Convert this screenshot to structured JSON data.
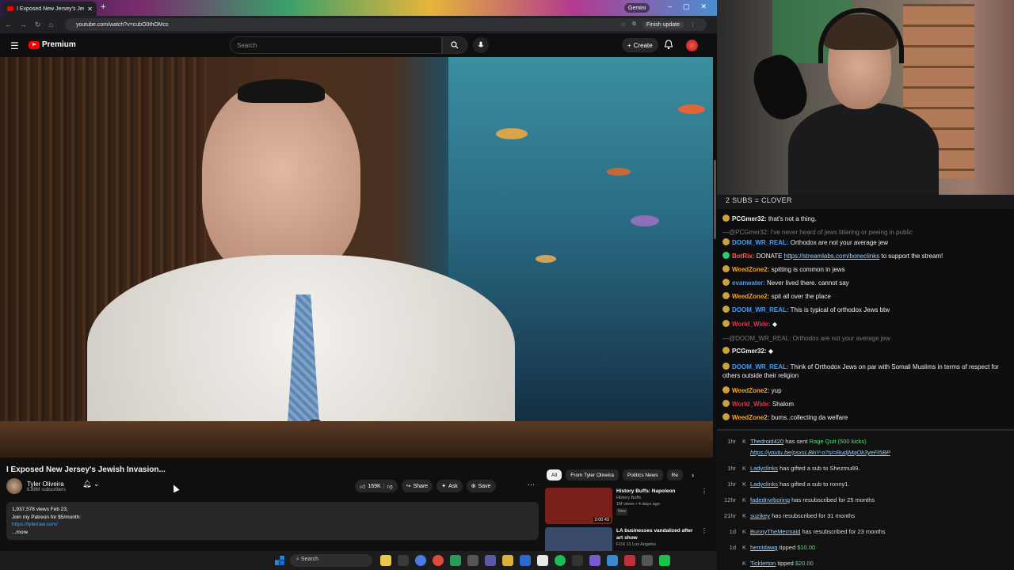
{
  "browser": {
    "tab_title": "I Exposed New Jersey's Jew",
    "badge": "Gemini",
    "url": "youtube.com/watch?v=cubO0thOMcs",
    "finish_update": "Finish update"
  },
  "youtube": {
    "logo_text": "Premium",
    "search_placeholder": "Search",
    "create_label": "Create"
  },
  "video": {
    "title": "I Exposed New Jersey's Jewish Invasion...",
    "channel_name": "Tyler Oliveira",
    "subscribers": "8.88M subscribers",
    "likes": "169K",
    "share_label": "Share",
    "ask_label": "Ask",
    "save_label": "Save",
    "desc_stats": "1,937,578 views  Feb 23,",
    "desc_line2": "Join my Patreon for $5/month:",
    "desc_link": "https://tylerraw.com/",
    "desc_more": "...more"
  },
  "related": {
    "chips": [
      "All",
      "From Tyler Oliveira",
      "Politics News",
      "Re"
    ],
    "items": [
      {
        "title": "History Buffs: Napoleon",
        "channel": "History Buffs",
        "meta": "1M views • 4 days ago",
        "badge": "New",
        "duration": "2:00:43",
        "thumb_color": "#7a1f1a"
      },
      {
        "title": "LA businesses vandalized after art show",
        "channel": "FOX 11 Los Angeles",
        "meta": "",
        "badge": "",
        "duration": "",
        "thumb_color": "#3a4a6a"
      }
    ]
  },
  "taskbar": {
    "search_label": "Search"
  },
  "chat": {
    "banner": "2 SUBS = CLOVER",
    "messages": [
      {
        "user": "PCGmer32",
        "color": "#efeff1",
        "text": "that's not a thing.",
        "icon": "gold"
      },
      {
        "reply": "@PCGmer32: I've never heard of jews littering or peeing in public"
      },
      {
        "user": "DOOM_WR_REAL",
        "color": "#3da0ff",
        "text": "Orthodox are not your average jew",
        "icon": "gold"
      },
      {
        "user": "BotRix",
        "color": "#ff5555",
        "text": "DONATE",
        "link": "https://streamlabs.com/boneclinks",
        "after": "to support the stream!",
        "icon": "green"
      },
      {
        "user": "WeedZone2",
        "color": "#f5a623",
        "text": "spitting is common in jews",
        "icon": "gold"
      },
      {
        "user": "evanwater",
        "color": "#3da0ff",
        "text": "Never lived there. cannot say",
        "icon": "gold"
      },
      {
        "user": "WeedZone2",
        "color": "#f5a623",
        "text": "spit all over the place",
        "icon": "gold"
      },
      {
        "user": "DOOM_WR_REAL",
        "color": "#3da0ff",
        "text": "This is typical of orthodox Jews btw",
        "icon": "gold"
      },
      {
        "user": "World_Wide",
        "color": "#e0344c",
        "text": "",
        "icon": "gold"
      },
      {
        "reply": "@DOOM_WR_REAL: Orthodox are not your average jew"
      },
      {
        "user": "PCGmer32",
        "color": "#efeff1",
        "text": "",
        "icon": "gold"
      },
      {
        "user": "DOOM_WR_REAL",
        "color": "#3da0ff",
        "text": "Think of Orthodox Jews on par with Somali Muslims in terms of respect for others outside their religion",
        "icon": "gold"
      },
      {
        "user": "WeedZone2",
        "color": "#f5a623",
        "text": "yup",
        "icon": "gold"
      },
      {
        "user": "World_Wide",
        "color": "#e0344c",
        "text": "Shalom",
        "icon": "gold"
      },
      {
        "user": "WeedZone2",
        "color": "#f5a623",
        "text": "bums..collecting da welfare",
        "icon": "gold"
      }
    ]
  },
  "events": [
    {
      "time": "1hr",
      "name": "Thedroid420",
      "text": "has sent",
      "green": "Rage Quit (500 kicks)",
      "link": "https://youtu.be/psxsLBkiY-o?si=RudjMqOk3yeFI5BP"
    },
    {
      "time": "1hr",
      "name": "Ladyclinks",
      "text": "has gifted a sub to",
      "target": "Shezmu89."
    },
    {
      "time": "1hr",
      "name": "Ladyclinks",
      "text": "has gifted a sub to",
      "target": "ronny1."
    },
    {
      "time": "12hr",
      "name": "fadednvrboring",
      "text": "has resubscribed for 25 months"
    },
    {
      "time": "21hr",
      "name": "suzikey",
      "text": "has resubscribed for 31 months"
    },
    {
      "time": "1d",
      "name": "BunnyTheMermaid",
      "text": "has resubscribed for 23 months"
    },
    {
      "time": "1d",
      "name": "hemtdawg",
      "text": "tipped",
      "amount": "$10.00"
    },
    {
      "time": "",
      "name": "Ticklerton",
      "text": "tipped",
      "amount": "$20.00"
    }
  ]
}
